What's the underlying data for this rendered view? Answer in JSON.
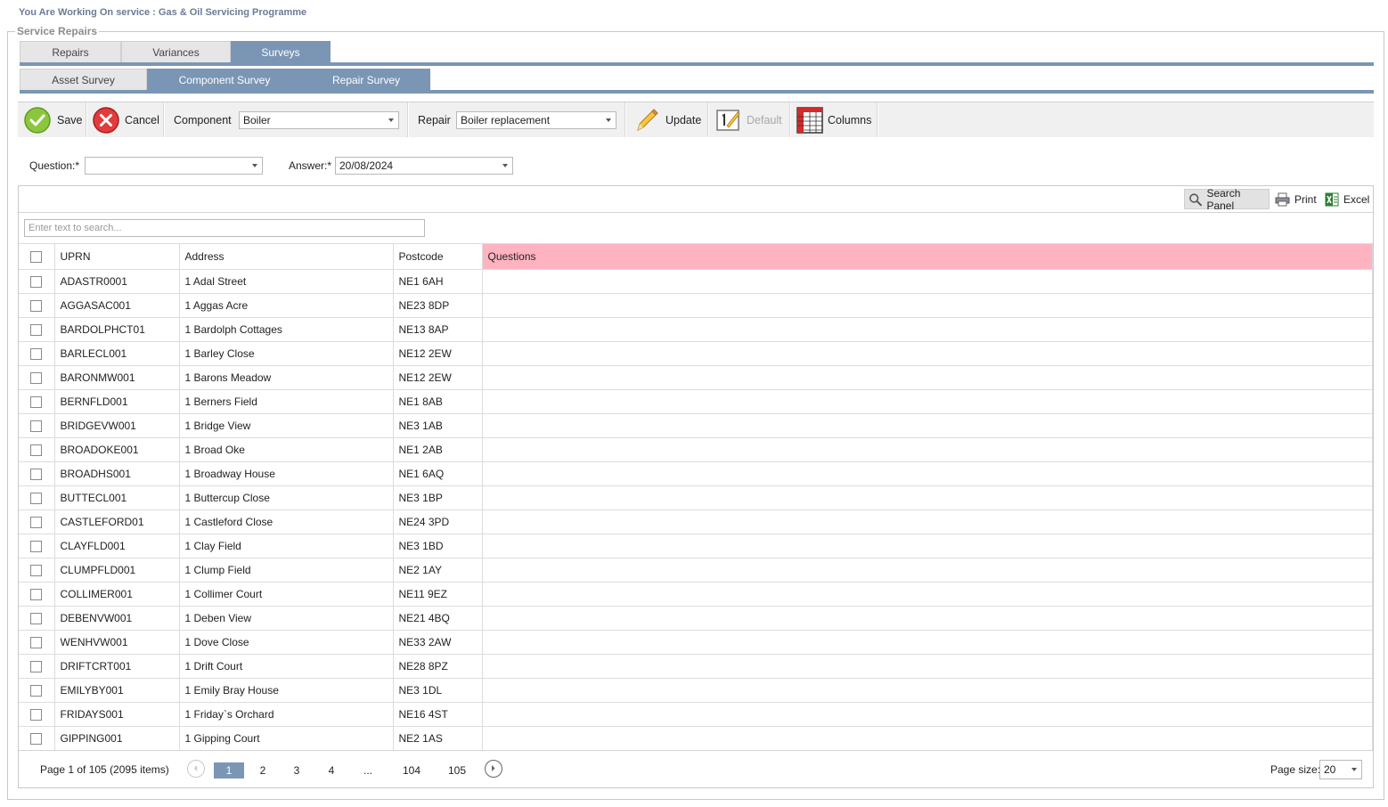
{
  "service_line": "You Are Working On service : Gas & Oil Servicing Programme",
  "frame_legend": "Service Repairs",
  "tabs": [
    "Repairs",
    "Variances",
    "Surveys"
  ],
  "subtabs": [
    "Asset Survey",
    "Component Survey",
    "Repair Survey"
  ],
  "toolbar": {
    "save": "Save",
    "cancel": "Cancel",
    "component_label": "Component",
    "component_value": "Boiler",
    "repair_label": "Repair",
    "repair_value": "Boiler replacement",
    "update": "Update",
    "default": "Default",
    "columns": "Columns"
  },
  "filters": {
    "question_label": "Question:*",
    "question_value": "",
    "answer_label": "Answer:*",
    "answer_value": "20/08/2024"
  },
  "grid_toolbar": {
    "search_panel": "Search Panel",
    "print": "Print",
    "excel": "Excel"
  },
  "search": {
    "placeholder": "Enter text to search..."
  },
  "columns": [
    "UPRN",
    "Address",
    "Postcode",
    "Questions"
  ],
  "rows": [
    [
      "ADASTR0001",
      "1 Adal Street",
      "NE1 6AH"
    ],
    [
      "AGGASAC001",
      "1 Aggas Acre",
      "NE23 8DP"
    ],
    [
      "BARDOLPHCT01",
      "1 Bardolph Cottages",
      "NE13 8AP"
    ],
    [
      "BARLECL001",
      "1 Barley Close",
      "NE12 2EW"
    ],
    [
      "BARONMW001",
      "1 Barons Meadow",
      "NE12 2EW"
    ],
    [
      "BERNFLD001",
      "1 Berners Field",
      "NE1 8AB"
    ],
    [
      "BRIDGEVW001",
      "1 Bridge View",
      "NE3 1AB"
    ],
    [
      "BROADOKE001",
      "1 Broad Oke",
      "NE1 2AB"
    ],
    [
      "BROADHS001",
      "1 Broadway House",
      "NE1 6AQ"
    ],
    [
      "BUTTECL001",
      "1 Buttercup Close",
      "NE3 1BP"
    ],
    [
      "CASTLEFORD01",
      "1 Castleford Close",
      "NE24 3PD"
    ],
    [
      "CLAYFLD001",
      "1 Clay Field",
      "NE3 1BD"
    ],
    [
      "CLUMPFLD001",
      "1 Clump Field",
      "NE2 1AY"
    ],
    [
      "COLLIMER001",
      "1 Collimer Court",
      "NE11 9EZ"
    ],
    [
      "DEBENVW001",
      "1 Deben View",
      "NE21 4BQ"
    ],
    [
      "WENHVW001",
      "1 Dove Close",
      "NE33 2AW"
    ],
    [
      "DRIFTCRT001",
      "1 Drift Court",
      "NE28 8PZ"
    ],
    [
      "EMILYBY001",
      "1 Emily Bray House",
      "NE3 1DL"
    ],
    [
      "FRIDAYS001",
      "1 Friday`s Orchard",
      "NE16 4ST"
    ],
    [
      "GIPPING001",
      "1 Gipping Court",
      "NE2 1AS"
    ]
  ],
  "pager": {
    "info": "Page 1 of 105 (2095 items)",
    "pages": [
      "1",
      "2",
      "3",
      "4",
      "...",
      "104",
      "105"
    ],
    "page_size_label": "Page size:",
    "page_size_value": "20"
  }
}
